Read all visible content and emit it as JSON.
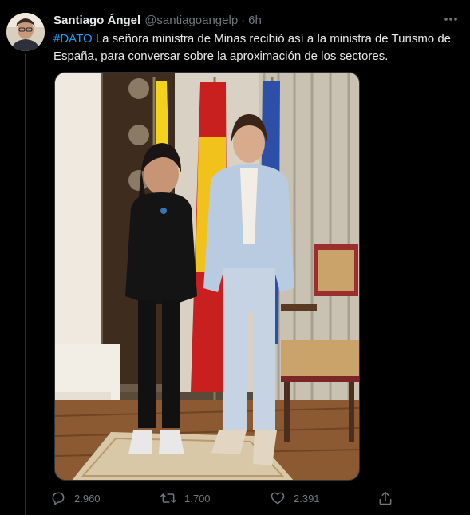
{
  "tweet": {
    "author": {
      "display_name": "Santiago Ángel",
      "handle": "@santiagoangelp",
      "separator": "·",
      "time": "6h"
    },
    "text": {
      "hashtag": "#DATO",
      "body": " La señora ministra de Minas recibió así a la ministra de Turismo de España, para conversar sobre la aproximación de los sectores."
    },
    "stats": {
      "replies": "2.960",
      "retweets": "1.700",
      "likes": "2.391"
    }
  },
  "icons": {
    "more": "more-dots-icon",
    "reply": "reply-bubble-icon",
    "retweet": "retweet-arrows-icon",
    "like": "heart-icon",
    "share": "share-upload-icon"
  },
  "colors": {
    "background": "#000000",
    "text": "#e7e9ea",
    "muted": "#71767b",
    "accent": "#1d9bf0",
    "border": "#2f3336"
  }
}
